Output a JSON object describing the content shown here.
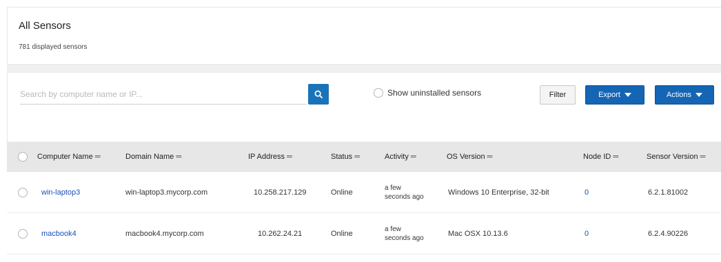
{
  "header": {
    "title": "All Sensors",
    "subtitle": "781 displayed sensors"
  },
  "toolbar": {
    "search_placeholder": "Search by computer name or IP...",
    "search_value": "",
    "show_uninstalled_label": "Show uninstalled sensors",
    "filter_label": "Filter",
    "export_label": "Export",
    "actions_label": "Actions"
  },
  "table": {
    "sort_symbol": "═",
    "columns": [
      "Computer Name",
      "Domain Name",
      "IP Address",
      "Status",
      "Activity",
      "OS Version",
      "Node ID",
      "Sensor Version"
    ],
    "rows": [
      {
        "computer_name": "win-laptop3",
        "domain_name": "win-laptop3.mycorp.com",
        "ip_address": "10.258.217.129",
        "status": "Online",
        "activity": "a few seconds ago",
        "os_version": "Windows 10 Enterprise, 32-bit",
        "node_id": "0",
        "sensor_version": "6.2.1.81002"
      },
      {
        "computer_name": "macbook4",
        "domain_name": "macbook4.mycorp.com",
        "ip_address": "10.262.24.21",
        "status": "Online",
        "activity": "a few seconds ago",
        "os_version": "Mac OSX 10.13.6",
        "node_id": "0",
        "sensor_version": "6.2.4.90226"
      }
    ]
  },
  "icons": {
    "search": "search-icon",
    "caret": "caret-down-icon"
  },
  "colors": {
    "primary": "#1565b5",
    "link": "#1a4fbb",
    "header_bg": "#e7e7e7"
  }
}
